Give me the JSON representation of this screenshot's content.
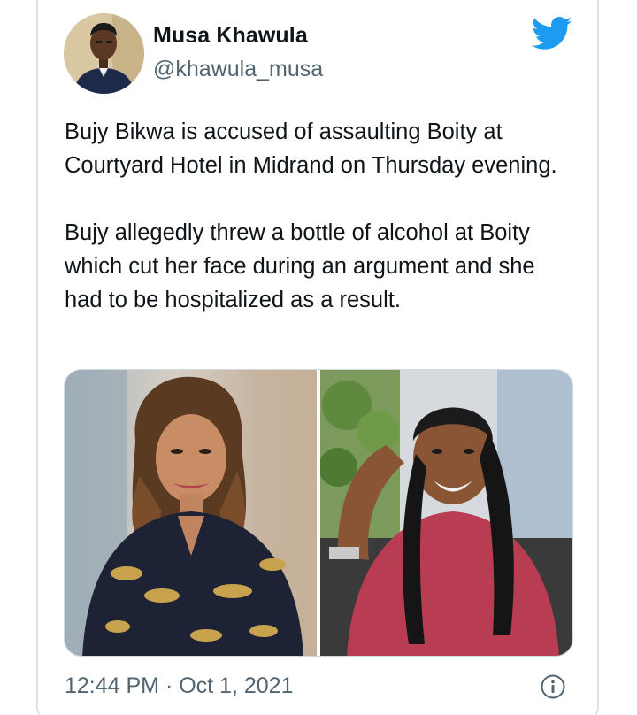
{
  "author": {
    "display_name": "Musa Khawula",
    "handle": "@khawula_musa"
  },
  "tweet": {
    "paragraphs": [
      "Bujy Bikwa is accused of assaulting Boity at Courtyard Hotel in Midrand on Thursday evening.",
      "Bujy allegedly threw a bottle of alcohol at Boity which cut her face during an argument and she had to be hospitalized as a result."
    ],
    "timestamp": "12:44 PM · Oct 1, 2021"
  },
  "icons": {
    "brand": "twitter-bird-icon",
    "info": "info-icon"
  },
  "colors": {
    "twitter_blue": "#1d9bf0",
    "text_primary": "#0f1419",
    "text_secondary": "#536471",
    "border": "#dfe3e7"
  }
}
